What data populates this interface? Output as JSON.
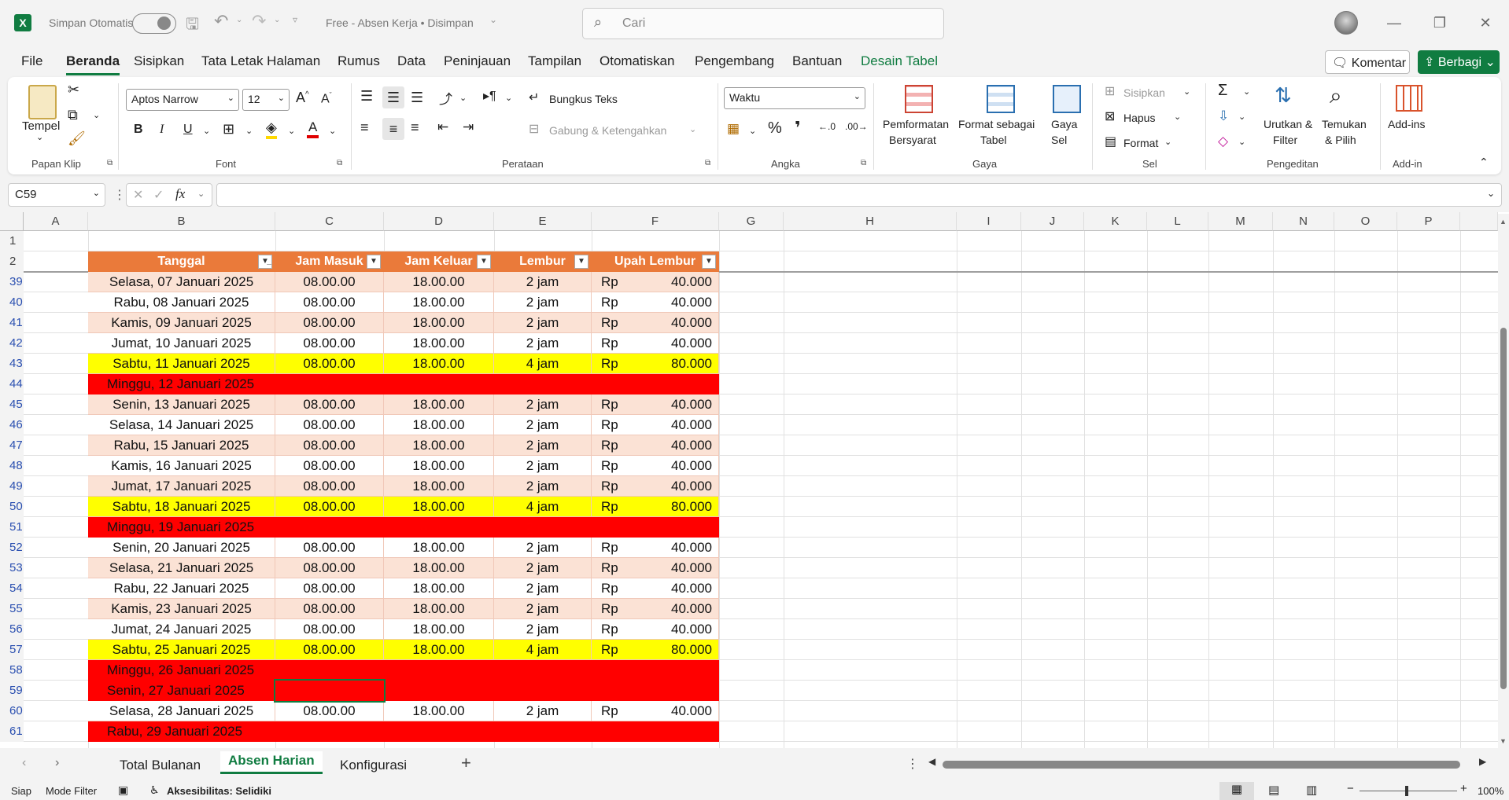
{
  "titlebar": {
    "autosave_label": "Simpan Otomatis",
    "doc_title": "Free - Absen Kerja • Disimpan",
    "search_placeholder": "Cari"
  },
  "menu": {
    "items": [
      "File",
      "Beranda",
      "Sisipkan",
      "Tata Letak Halaman",
      "Rumus",
      "Data",
      "Peninjauan",
      "Tampilan",
      "Otomatiskan",
      "Pengembang",
      "Bantuan",
      "Desain Tabel"
    ],
    "comment_btn": "Komentar",
    "share_btn": "Berbagi"
  },
  "ribbon": {
    "clipboard": {
      "paste": "Tempel",
      "label": "Papan Klip"
    },
    "font": {
      "name": "Aptos Narrow",
      "size": "12",
      "label": "Font"
    },
    "alignment": {
      "wrap": "Bungkus Teks",
      "merge": "Gabung & Ketengahkan",
      "label": "Perataan"
    },
    "number": {
      "format": "Waktu",
      "label": "Angka"
    },
    "styles": {
      "cond": "Pemformatan",
      "cond2": "Bersyarat",
      "table": "Format sebagai",
      "table2": "Tabel",
      "cell": "Gaya",
      "cell2": "Sel",
      "label": "Gaya"
    },
    "cells": {
      "insert": "Sisipkan",
      "delete": "Hapus",
      "format": "Format",
      "label": "Sel"
    },
    "editing": {
      "sort": "Urutkan &",
      "sort2": "Filter",
      "find": "Temukan",
      "find2": "& Pilih",
      "label": "Pengeditan"
    },
    "addins": {
      "btn": "Add-ins",
      "label": "Add-in"
    }
  },
  "formula": {
    "namebox": "C59",
    "value": ""
  },
  "columns": [
    "A",
    "B",
    "C",
    "D",
    "E",
    "F",
    "G",
    "H",
    "I",
    "J",
    "K",
    "L",
    "M",
    "N",
    "O",
    "P"
  ],
  "table": {
    "headers": [
      "Tanggal",
      "Jam Masuk",
      "Jam Keluar",
      "Lembur",
      "Upah Lembur"
    ],
    "rows": [
      {
        "n": "39",
        "date": "Selasa, 07 Januari 2025",
        "in": "08.00.00",
        "out": "18.00.00",
        "ot": "2 jam",
        "cur": "Rp",
        "pay": "40.000",
        "kind": "band"
      },
      {
        "n": "40",
        "date": "Rabu, 08 Januari 2025",
        "in": "08.00.00",
        "out": "18.00.00",
        "ot": "2 jam",
        "cur": "Rp",
        "pay": "40.000",
        "kind": "white"
      },
      {
        "n": "41",
        "date": "Kamis, 09 Januari 2025",
        "in": "08.00.00",
        "out": "18.00.00",
        "ot": "2 jam",
        "cur": "Rp",
        "pay": "40.000",
        "kind": "band"
      },
      {
        "n": "42",
        "date": "Jumat, 10 Januari 2025",
        "in": "08.00.00",
        "out": "18.00.00",
        "ot": "2 jam",
        "cur": "Rp",
        "pay": "40.000",
        "kind": "white"
      },
      {
        "n": "43",
        "date": "Sabtu, 11 Januari 2025",
        "in": "08.00.00",
        "out": "18.00.00",
        "ot": "4 jam",
        "cur": "Rp",
        "pay": "80.000",
        "kind": "yellow"
      },
      {
        "n": "44",
        "date": "Minggu, 12 Januari 2025",
        "in": "",
        "out": "",
        "ot": "",
        "cur": "",
        "pay": "",
        "kind": "red"
      },
      {
        "n": "45",
        "date": "Senin, 13 Januari 2025",
        "in": "08.00.00",
        "out": "18.00.00",
        "ot": "2 jam",
        "cur": "Rp",
        "pay": "40.000",
        "kind": "band"
      },
      {
        "n": "46",
        "date": "Selasa, 14 Januari 2025",
        "in": "08.00.00",
        "out": "18.00.00",
        "ot": "2 jam",
        "cur": "Rp",
        "pay": "40.000",
        "kind": "white"
      },
      {
        "n": "47",
        "date": "Rabu, 15 Januari 2025",
        "in": "08.00.00",
        "out": "18.00.00",
        "ot": "2 jam",
        "cur": "Rp",
        "pay": "40.000",
        "kind": "band"
      },
      {
        "n": "48",
        "date": "Kamis, 16 Januari 2025",
        "in": "08.00.00",
        "out": "18.00.00",
        "ot": "2 jam",
        "cur": "Rp",
        "pay": "40.000",
        "kind": "white"
      },
      {
        "n": "49",
        "date": "Jumat, 17 Januari 2025",
        "in": "08.00.00",
        "out": "18.00.00",
        "ot": "2 jam",
        "cur": "Rp",
        "pay": "40.000",
        "kind": "band"
      },
      {
        "n": "50",
        "date": "Sabtu, 18 Januari 2025",
        "in": "08.00.00",
        "out": "18.00.00",
        "ot": "4 jam",
        "cur": "Rp",
        "pay": "80.000",
        "kind": "yellow"
      },
      {
        "n": "51",
        "date": "Minggu, 19 Januari 2025",
        "in": "",
        "out": "",
        "ot": "",
        "cur": "",
        "pay": "",
        "kind": "red"
      },
      {
        "n": "52",
        "date": "Senin, 20 Januari 2025",
        "in": "08.00.00",
        "out": "18.00.00",
        "ot": "2 jam",
        "cur": "Rp",
        "pay": "40.000",
        "kind": "white"
      },
      {
        "n": "53",
        "date": "Selasa, 21 Januari 2025",
        "in": "08.00.00",
        "out": "18.00.00",
        "ot": "2 jam",
        "cur": "Rp",
        "pay": "40.000",
        "kind": "band"
      },
      {
        "n": "54",
        "date": "Rabu, 22 Januari 2025",
        "in": "08.00.00",
        "out": "18.00.00",
        "ot": "2 jam",
        "cur": "Rp",
        "pay": "40.000",
        "kind": "white"
      },
      {
        "n": "55",
        "date": "Kamis, 23 Januari 2025",
        "in": "08.00.00",
        "out": "18.00.00",
        "ot": "2 jam",
        "cur": "Rp",
        "pay": "40.000",
        "kind": "band"
      },
      {
        "n": "56",
        "date": "Jumat, 24 Januari 2025",
        "in": "08.00.00",
        "out": "18.00.00",
        "ot": "2 jam",
        "cur": "Rp",
        "pay": "40.000",
        "kind": "white"
      },
      {
        "n": "57",
        "date": "Sabtu, 25 Januari 2025",
        "in": "08.00.00",
        "out": "18.00.00",
        "ot": "4 jam",
        "cur": "Rp",
        "pay": "80.000",
        "kind": "yellow"
      },
      {
        "n": "58",
        "date": "Minggu, 26 Januari 2025",
        "in": "",
        "out": "",
        "ot": "",
        "cur": "",
        "pay": "",
        "kind": "red"
      },
      {
        "n": "59",
        "date": "Senin, 27 Januari 2025",
        "in": "",
        "out": "",
        "ot": "",
        "cur": "",
        "pay": "",
        "kind": "red"
      },
      {
        "n": "60",
        "date": "Selasa, 28 Januari 2025",
        "in": "08.00.00",
        "out": "18.00.00",
        "ot": "2 jam",
        "cur": "Rp",
        "pay": "40.000",
        "kind": "white"
      },
      {
        "n": "61",
        "date": "Rabu, 29 Januari 2025",
        "in": "",
        "out": "",
        "ot": "",
        "cur": "",
        "pay": "",
        "kind": "red"
      }
    ]
  },
  "sheets": [
    "Total Bulanan",
    "Absen Harian",
    "Konfigurasi"
  ],
  "active_sheet": "Absen Harian",
  "status": {
    "ready": "Siap",
    "mode": "Mode Filter",
    "access": "Aksesibilitas: Selidiki",
    "zoom": "100%"
  },
  "colors": {
    "accent": "#107c41",
    "header": "#ea7a3a",
    "band": "#fbe2d5",
    "yellow": "#ffff00",
    "red": "#ff0000"
  }
}
